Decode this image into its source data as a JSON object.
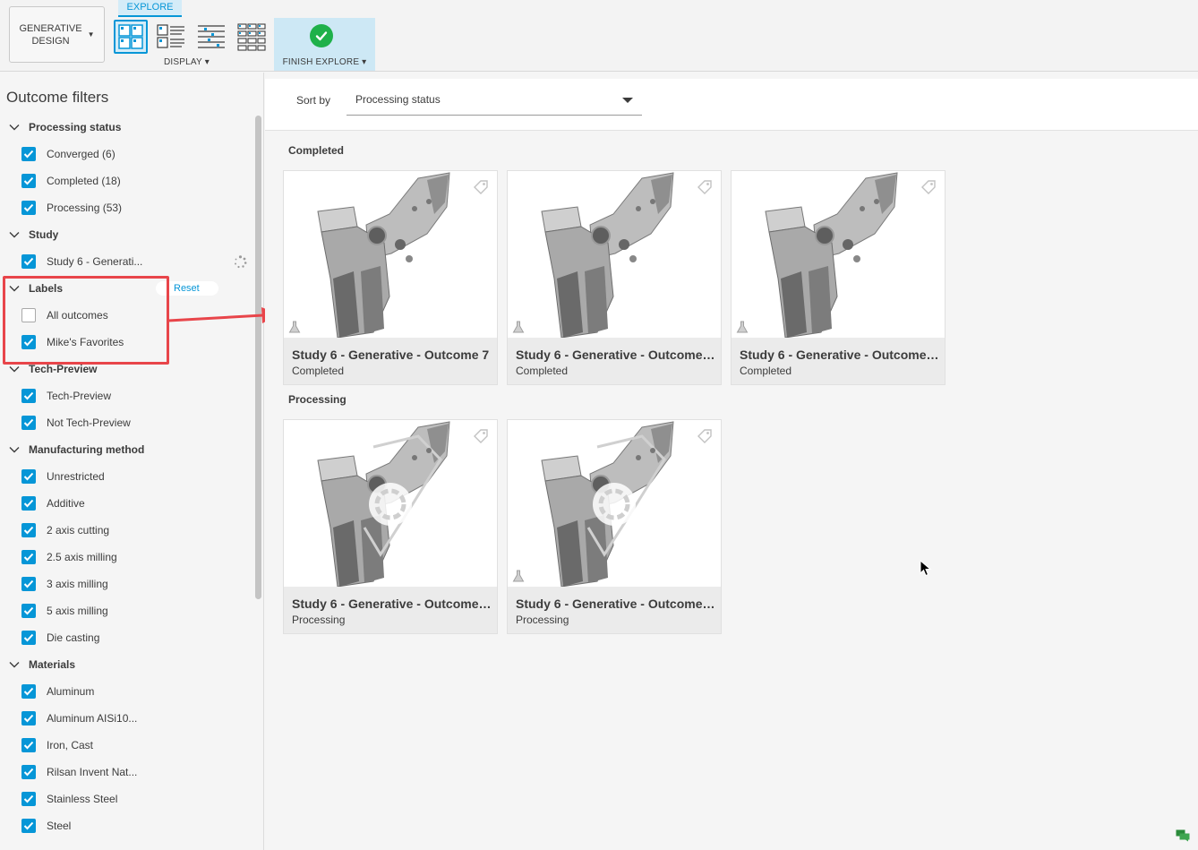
{
  "toolbar": {
    "workspace_line1": "GENERATIVE",
    "workspace_line2": "DESIGN",
    "explore_tab": "EXPLORE",
    "display_label": "DISPLAY ▾",
    "finish_label": "FINISH EXPLORE ▾"
  },
  "sidebar": {
    "title": "Outcome filters",
    "sections": [
      {
        "header": "Processing status",
        "items": [
          {
            "label": "Converged (6)",
            "checked": true
          },
          {
            "label": "Completed (18)",
            "checked": true
          },
          {
            "label": "Processing (53)",
            "checked": true
          }
        ]
      },
      {
        "header": "Study",
        "items": [
          {
            "label": "Study 6 - Generati...",
            "checked": true
          }
        ]
      },
      {
        "header": "Labels",
        "reset": "Reset",
        "items": [
          {
            "label": "All outcomes",
            "checked": false
          },
          {
            "label": "Mike's Favorites",
            "checked": true
          }
        ]
      },
      {
        "header": "Tech-Preview",
        "items": [
          {
            "label": "Tech-Preview",
            "checked": true
          },
          {
            "label": "Not Tech-Preview",
            "checked": true
          }
        ]
      },
      {
        "header": "Manufacturing method",
        "items": [
          {
            "label": "Unrestricted",
            "checked": true
          },
          {
            "label": "Additive",
            "checked": true
          },
          {
            "label": "2 axis cutting",
            "checked": true
          },
          {
            "label": "2.5 axis milling",
            "checked": true
          },
          {
            "label": "3 axis milling",
            "checked": true
          },
          {
            "label": "5 axis milling",
            "checked": true
          },
          {
            "label": "Die casting",
            "checked": true
          }
        ]
      },
      {
        "header": "Materials",
        "items": [
          {
            "label": "Aluminum",
            "checked": true
          },
          {
            "label": "Aluminum AISi10...",
            "checked": true
          },
          {
            "label": "Iron, Cast",
            "checked": true
          },
          {
            "label": "Rilsan Invent Nat...",
            "checked": true
          },
          {
            "label": "Stainless Steel",
            "checked": true
          },
          {
            "label": "Steel",
            "checked": true
          }
        ]
      }
    ]
  },
  "main": {
    "sort_label": "Sort by",
    "sort_value": "Processing status",
    "groups": [
      {
        "title": "Completed",
        "cards": [
          {
            "name": "Study 6 - Generative - Outcome 7",
            "status": "Completed",
            "processing": false
          },
          {
            "name": "Study 6 - Generative - Outcome ...",
            "status": "Completed",
            "processing": false
          },
          {
            "name": "Study 6 - Generative - Outcome ...",
            "status": "Completed",
            "processing": false
          }
        ]
      },
      {
        "title": "Processing",
        "cards": [
          {
            "name": "Study 6 - Generative - Outcome ...",
            "status": "Processing",
            "processing": true
          },
          {
            "name": "Study 6 - Generative - Outcome ...",
            "status": "Processing",
            "processing": true
          }
        ]
      }
    ]
  },
  "colors": {
    "accent": "#0696d7",
    "highlight": "#e8454a",
    "finish_bg": "#cde8f5",
    "check_green": "#1fb14a"
  },
  "icons": {
    "workspace_caret": "caret-down-icon",
    "finish": "check-circle-icon",
    "tag": "tag-icon",
    "flask": "flask-icon",
    "spinner": "spinner-icon"
  }
}
